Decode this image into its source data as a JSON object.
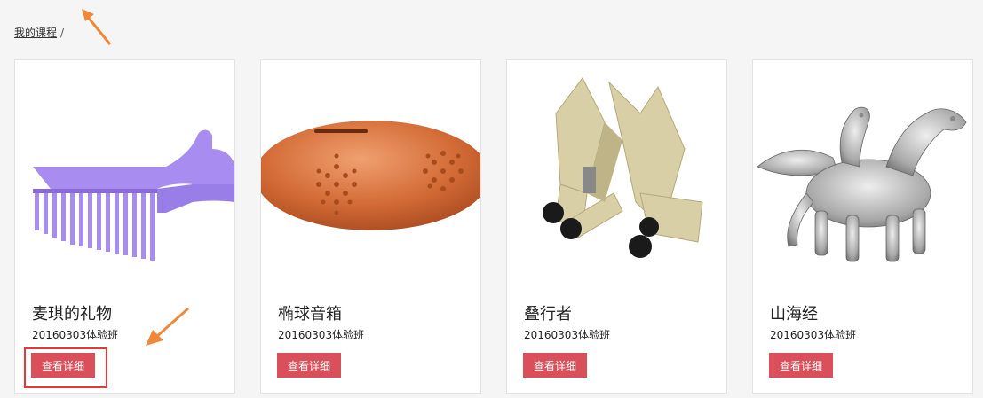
{
  "breadcrumb": {
    "link": "我的课程",
    "separator": "/"
  },
  "courses": [
    {
      "title": "麦琪的礼物",
      "class": "20160303体验班",
      "button": "查看详细",
      "image": "purple-comb-model"
    },
    {
      "title": "椭球音箱",
      "class": "20160303体验班",
      "button": "查看详细",
      "image": "orange-ellipsoid-speaker-model"
    },
    {
      "title": "叠行者",
      "class": "20160303体验班",
      "button": "查看详细",
      "image": "folding-walker-model"
    },
    {
      "title": "山海经",
      "class": "20160303体验班",
      "button": "查看详细",
      "image": "mythical-beast-model"
    }
  ],
  "colors": {
    "button": "#d9505a",
    "highlight": "#e53935",
    "annotation_arrow": "#f0883a"
  }
}
